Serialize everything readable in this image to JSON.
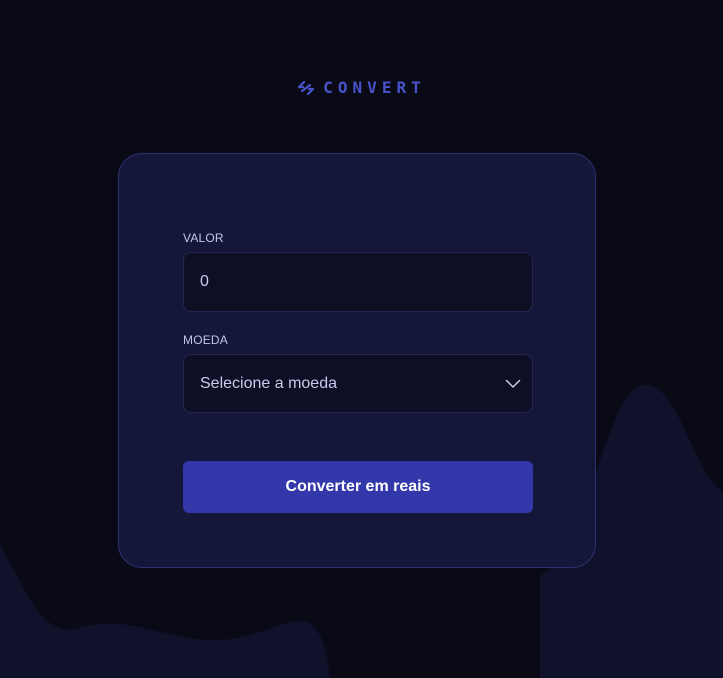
{
  "brand": {
    "name": "CONVERT",
    "icon": "convert-arrows-icon",
    "color": "#4753c9"
  },
  "form": {
    "amount_label": "VALOR",
    "amount_value": "0",
    "currency_label": "MOEDA",
    "currency_selected": "Selecione a moeda",
    "currency_icon": "chevron-down-icon",
    "submit_label": "Converter em reais"
  },
  "colors": {
    "background": "#0a0a17",
    "card": "#15173a",
    "accent": "#3237aa"
  }
}
